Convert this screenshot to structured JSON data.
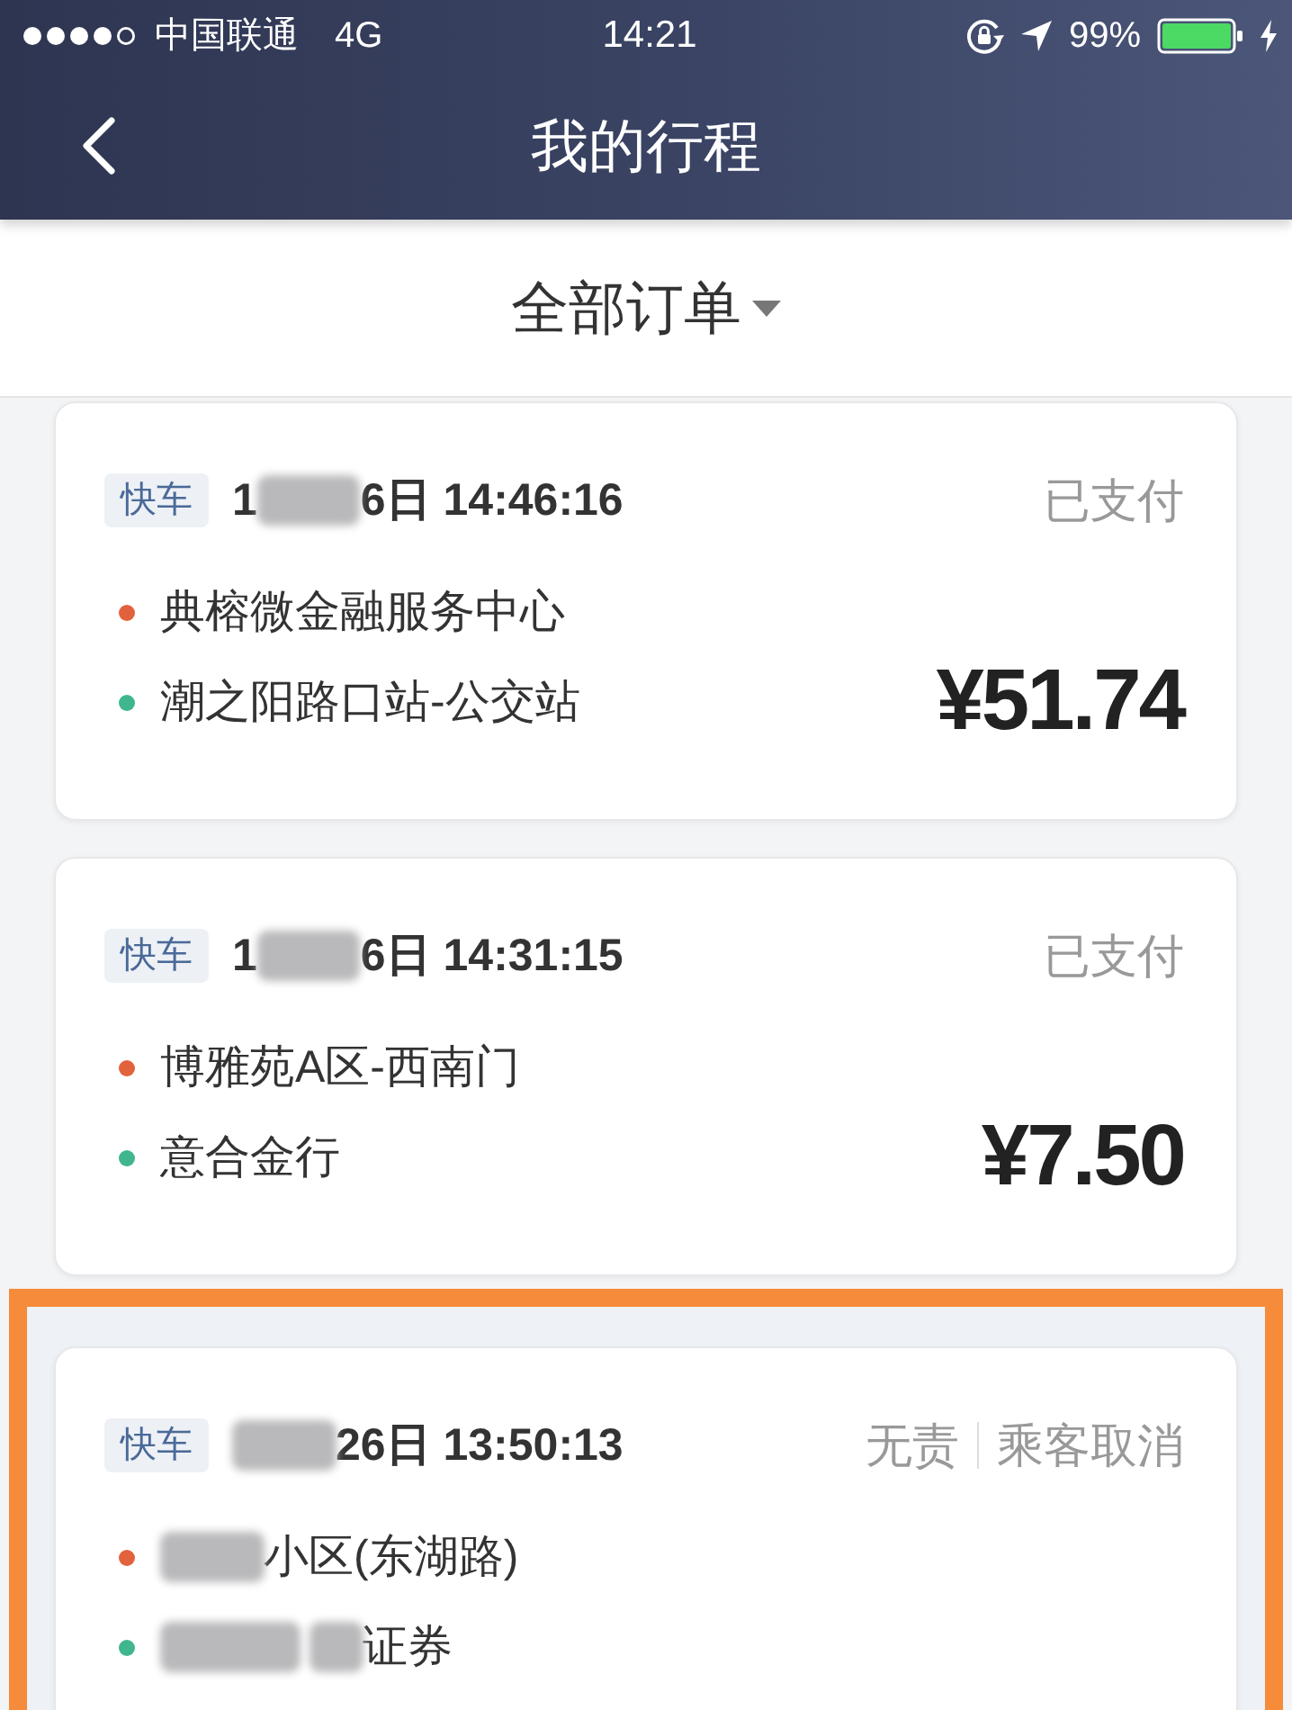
{
  "status_bar": {
    "carrier": "中国联通",
    "network": "4G",
    "time": "14:21",
    "battery": "99%"
  },
  "nav": {
    "title": "我的行程"
  },
  "filter": {
    "label": "全部订单"
  },
  "orders": [
    {
      "badge": "快车",
      "time": [
        {
          "kind": "text",
          "text": "1"
        },
        {
          "kind": "blur"
        },
        {
          "kind": "text",
          "text": "6日 14:46:16"
        }
      ],
      "status": [
        "已支付"
      ],
      "from": [
        {
          "kind": "text",
          "text": "典榕微金融服务中心"
        }
      ],
      "to": [
        {
          "kind": "text",
          "text": "潮之阳路口站-公交站"
        }
      ],
      "price": "¥51.74",
      "highlighted": false
    },
    {
      "badge": "快车",
      "time": [
        {
          "kind": "text",
          "text": "1"
        },
        {
          "kind": "blur"
        },
        {
          "kind": "text",
          "text": "6日 14:31:15"
        }
      ],
      "status": [
        "已支付"
      ],
      "from": [
        {
          "kind": "text",
          "text": "博雅苑A区-西南门"
        }
      ],
      "to": [
        {
          "kind": "text",
          "text": "意合金行"
        }
      ],
      "price": "¥7.50",
      "highlighted": false
    },
    {
      "badge": "快车",
      "time": [
        {
          "kind": "blur"
        },
        {
          "kind": "text",
          "text": "26日 13:50:13"
        }
      ],
      "status": [
        "无责",
        "乘客取消"
      ],
      "from": [
        {
          "kind": "blur"
        },
        {
          "kind": "text",
          "text": "小区(东湖路)"
        }
      ],
      "to": [
        {
          "kind": "blur-wide"
        },
        {
          "kind": "blur-narrow"
        },
        {
          "kind": "text",
          "text": "证券"
        }
      ],
      "highlighted": true
    }
  ]
}
